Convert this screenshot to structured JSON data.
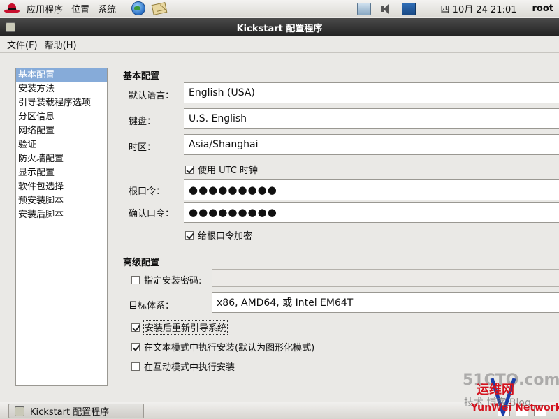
{
  "top_panel": {
    "menus": [
      "应用程序",
      "位置",
      "系统"
    ],
    "clock": "四 10月 24 21:01",
    "user": "root"
  },
  "window": {
    "title": "Kickstart 配置程序",
    "menubar": [
      "文件(F)",
      "帮助(H)"
    ]
  },
  "nav": {
    "items": [
      "基本配置",
      "安装方法",
      "引导装载程序选项",
      "分区信息",
      "网络配置",
      "验证",
      "防火墙配置",
      "显示配置",
      "软件包选择",
      "预安装脚本",
      "安装后脚本"
    ],
    "selected_index": 0
  },
  "basic": {
    "section_title": "基本配置",
    "language_label": "默认语言：",
    "language_value": "English (USA)",
    "keyboard_label": "键盘：",
    "keyboard_value": "U.S. English",
    "timezone_label": "时区：",
    "timezone_value": "Asia/Shanghai",
    "utc_label": "使用 UTC 时钟",
    "utc_checked": true,
    "root_password_label": "根口令：",
    "root_password_value": "●●●●●●●●●",
    "confirm_password_label": "确认口令：",
    "confirm_password_value": "●●●●●●●●●",
    "encrypt_label": "给根口令加密",
    "encrypt_checked": true
  },
  "advanced": {
    "section_title": "高级配置",
    "install_key_label": "指定安装密码:",
    "install_key_checked": false,
    "install_key_value": "",
    "arch_label": "目标体系：",
    "arch_value": "x86, AMD64, 或 Intel EM64T",
    "reboot_label": "安装后重新引导系统",
    "reboot_checked": true,
    "text_mode_label": "在文本模式中执行安装(默认为图形化模式)",
    "text_mode_checked": true,
    "interactive_label": "在互动模式中执行安装",
    "interactive_checked": false
  },
  "taskbar": {
    "task_label": "Kickstart 配置程序"
  },
  "watermark": {
    "site": "51CTO.com",
    "red_text": "运维网",
    "gray_text": "技术 博客  Blog",
    "english": "YunWei Network"
  },
  "colors": {
    "selection": "#86abd9",
    "titlebar": "#2e2e2e",
    "brand_red": "#c8102e"
  },
  "icons": {
    "distributor_logo": "redhat-logo-icon",
    "browser": "globe-icon",
    "mail": "mail-icon",
    "network": "network-icon",
    "volume": "volume-icon",
    "network_monitor": "network-monitor-icon"
  }
}
